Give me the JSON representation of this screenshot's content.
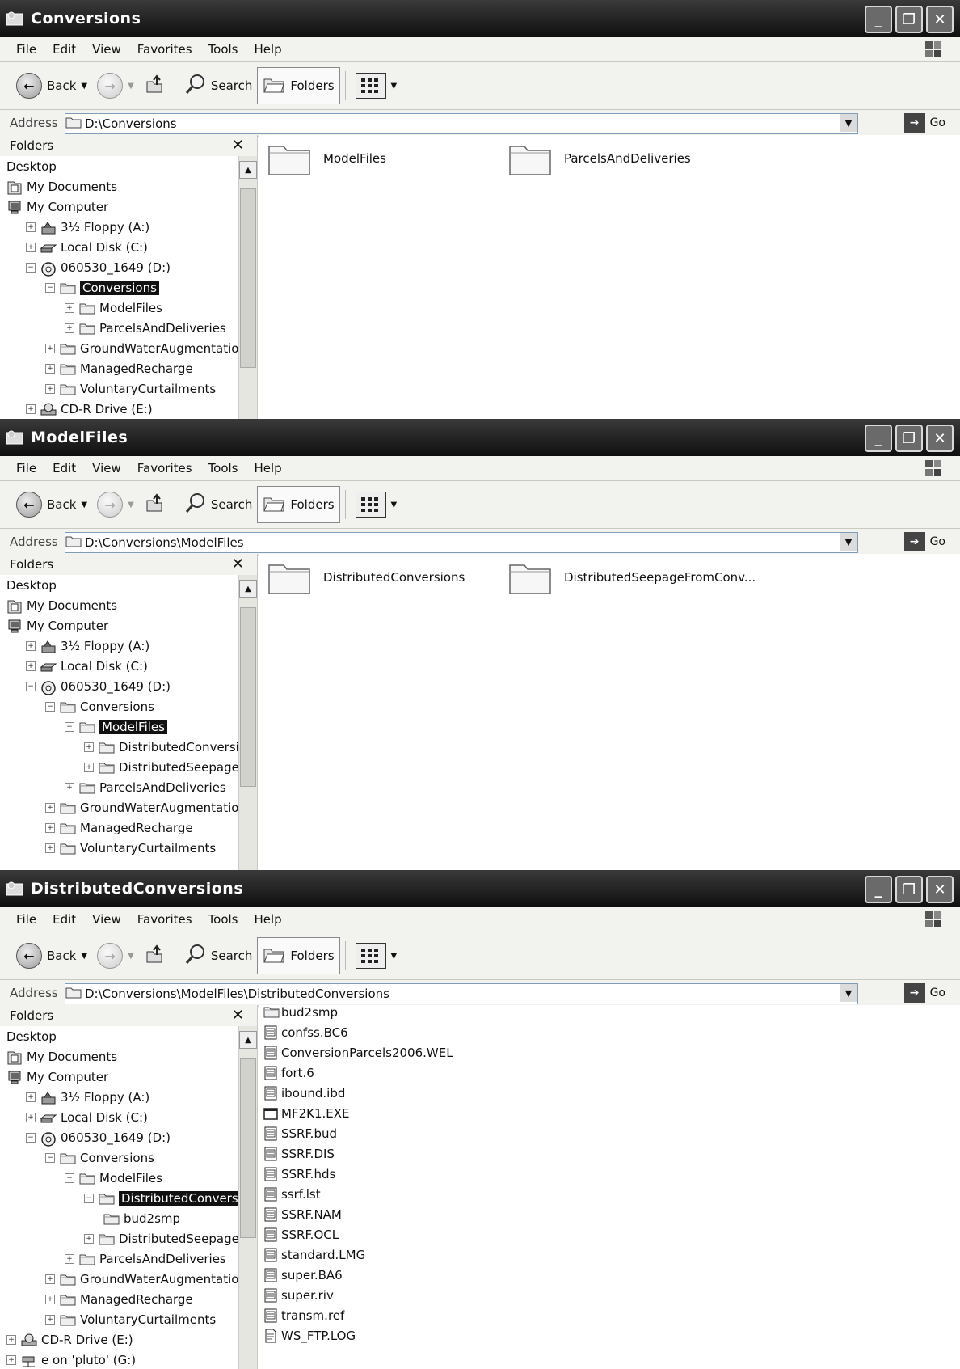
{
  "windows": [
    {
      "title": "Conversions",
      "menu": [
        "File",
        "Edit",
        "View",
        "Favorites",
        "Tools",
        "Help"
      ],
      "toolbar": {
        "back": "Back",
        "search": "Search",
        "folders": "Folders"
      },
      "address": {
        "label": "Address",
        "value": "D:\\Conversions",
        "go": "Go"
      },
      "folders_header": "Folders",
      "tree": [
        {
          "label": "Desktop",
          "icon": "none",
          "exp": "",
          "indent": 0
        },
        {
          "label": "My Documents",
          "icon": "documents-icon",
          "exp": "",
          "indent": 0
        },
        {
          "label": "My Computer",
          "icon": "computer-icon",
          "exp": "",
          "indent": 0
        },
        {
          "label": "3½ Floppy (A:)",
          "icon": "floppy-icon",
          "exp": "+",
          "indent": 1
        },
        {
          "label": "Local Disk (C:)",
          "icon": "disk-icon",
          "exp": "+",
          "indent": 1
        },
        {
          "label": "060530_1649 (D:)",
          "icon": "cd-icon",
          "exp": "-",
          "indent": 1
        },
        {
          "label": "Conversions",
          "icon": "folder-icon",
          "exp": "-",
          "indent": 2,
          "selected": true
        },
        {
          "label": "ModelFiles",
          "icon": "folder-icon",
          "exp": "+",
          "indent": 3
        },
        {
          "label": "ParcelsAndDeliveries",
          "icon": "folder-icon",
          "exp": "+",
          "indent": 3
        },
        {
          "label": "GroundWaterAugmentation",
          "icon": "folder-icon",
          "exp": "+",
          "indent": 2
        },
        {
          "label": "ManagedRecharge",
          "icon": "folder-icon",
          "exp": "+",
          "indent": 2
        },
        {
          "label": "VoluntaryCurtailments",
          "icon": "folder-icon",
          "exp": "+",
          "indent": 2
        },
        {
          "label": "CD-R Drive (E:)",
          "icon": "cdr-icon",
          "exp": "+",
          "indent": 1
        }
      ],
      "tiles": [
        "ModelFiles",
        "ParcelsAndDeliveries"
      ]
    },
    {
      "title": "ModelFiles",
      "menu": [
        "File",
        "Edit",
        "View",
        "Favorites",
        "Tools",
        "Help"
      ],
      "toolbar": {
        "back": "Back",
        "search": "Search",
        "folders": "Folders"
      },
      "address": {
        "label": "Address",
        "value": "D:\\Conversions\\ModelFiles",
        "go": "Go"
      },
      "folders_header": "Folders",
      "tree": [
        {
          "label": "Desktop",
          "icon": "none",
          "exp": "",
          "indent": 0
        },
        {
          "label": "My Documents",
          "icon": "documents-icon",
          "exp": "",
          "indent": 0
        },
        {
          "label": "My Computer",
          "icon": "computer-icon",
          "exp": "",
          "indent": 0
        },
        {
          "label": "3½ Floppy (A:)",
          "icon": "floppy-icon",
          "exp": "+",
          "indent": 1
        },
        {
          "label": "Local Disk (C:)",
          "icon": "disk-icon",
          "exp": "+",
          "indent": 1
        },
        {
          "label": "060530_1649 (D:)",
          "icon": "cd-icon",
          "exp": "-",
          "indent": 1
        },
        {
          "label": "Conversions",
          "icon": "folder-icon",
          "exp": "-",
          "indent": 2
        },
        {
          "label": "ModelFiles",
          "icon": "folder-icon",
          "exp": "-",
          "indent": 3,
          "selected": true
        },
        {
          "label": "DistributedConversic",
          "icon": "folder-icon",
          "exp": "+",
          "indent": 4
        },
        {
          "label": "DistributedSeepagef",
          "icon": "folder-icon",
          "exp": "+",
          "indent": 4
        },
        {
          "label": "ParcelsAndDeliveries",
          "icon": "folder-icon",
          "exp": "+",
          "indent": 3
        },
        {
          "label": "GroundWaterAugmentation",
          "icon": "folder-icon",
          "exp": "+",
          "indent": 2
        },
        {
          "label": "ManagedRecharge",
          "icon": "folder-icon",
          "exp": "+",
          "indent": 2
        },
        {
          "label": "VoluntaryCurtailments",
          "icon": "folder-icon",
          "exp": "+",
          "indent": 2
        }
      ],
      "tiles": [
        "DistributedConversions",
        "DistributedSeepageFromConv..."
      ]
    },
    {
      "title": "DistributedConversions",
      "menu": [
        "File",
        "Edit",
        "View",
        "Favorites",
        "Tools",
        "Help"
      ],
      "toolbar": {
        "back": "Back",
        "search": "Search",
        "folders": "Folders"
      },
      "address": {
        "label": "Address",
        "value": "D:\\Conversions\\ModelFiles\\DistributedConversions",
        "go": "Go"
      },
      "folders_header": "Folders",
      "tree": [
        {
          "label": "Desktop",
          "icon": "none",
          "exp": "",
          "indent": 0
        },
        {
          "label": "My Documents",
          "icon": "documents-icon",
          "exp": "",
          "indent": 0
        },
        {
          "label": "My Computer",
          "icon": "computer-icon",
          "exp": "",
          "indent": 0
        },
        {
          "label": "3½ Floppy (A:)",
          "icon": "floppy-icon",
          "exp": "+",
          "indent": 1
        },
        {
          "label": "Local Disk (C:)",
          "icon": "disk-icon",
          "exp": "+",
          "indent": 1
        },
        {
          "label": "060530_1649 (D:)",
          "icon": "cd-icon",
          "exp": "-",
          "indent": 1
        },
        {
          "label": "Conversions",
          "icon": "folder-icon",
          "exp": "-",
          "indent": 2
        },
        {
          "label": "ModelFiles",
          "icon": "folder-icon",
          "exp": "-",
          "indent": 3
        },
        {
          "label": "DistributedConversior",
          "icon": "folder-icon",
          "exp": "-",
          "indent": 4,
          "selected": true
        },
        {
          "label": "bud2smp",
          "icon": "folder-icon",
          "exp": "",
          "indent": 5
        },
        {
          "label": "DistributedSeepageFr",
          "icon": "folder-icon",
          "exp": "+",
          "indent": 4
        },
        {
          "label": "ParcelsAndDeliveries",
          "icon": "folder-icon",
          "exp": "+",
          "indent": 3
        },
        {
          "label": "GroundWaterAugmentation",
          "icon": "folder-icon",
          "exp": "+",
          "indent": 2
        },
        {
          "label": "ManagedRecharge",
          "icon": "folder-icon",
          "exp": "+",
          "indent": 2
        },
        {
          "label": "VoluntaryCurtailments",
          "icon": "folder-icon",
          "exp": "+",
          "indent": 2
        },
        {
          "label": "CD-R Drive (E:)",
          "icon": "cdr-icon",
          "exp": "+",
          "indent": 0
        },
        {
          "label": "e on 'pluto' (G:)",
          "icon": "network-drive-icon",
          "exp": "+",
          "indent": 0
        }
      ],
      "files": [
        {
          "name": "bud2smp",
          "icon": "folder-icon"
        },
        {
          "name": "confss.BC6",
          "icon": "file-icon"
        },
        {
          "name": "ConversionParcels2006.WEL",
          "icon": "file-icon"
        },
        {
          "name": "fort.6",
          "icon": "file-icon"
        },
        {
          "name": "ibound.ibd",
          "icon": "file-icon"
        },
        {
          "name": "MF2K1.EXE",
          "icon": "exe-icon"
        },
        {
          "name": "SSRF.bud",
          "icon": "file-icon"
        },
        {
          "name": "SSRF.DIS",
          "icon": "file-icon"
        },
        {
          "name": "SSRF.hds",
          "icon": "file-icon"
        },
        {
          "name": "ssrf.lst",
          "icon": "file-icon"
        },
        {
          "name": "SSRF.NAM",
          "icon": "file-icon"
        },
        {
          "name": "SSRF.OCL",
          "icon": "file-icon"
        },
        {
          "name": "standard.LMG",
          "icon": "file-icon"
        },
        {
          "name": "super.BA6",
          "icon": "file-icon"
        },
        {
          "name": "super.riv",
          "icon": "file-icon"
        },
        {
          "name": "transm.ref",
          "icon": "file-icon"
        },
        {
          "name": "WS_FTP.LOG",
          "icon": "text-file-icon"
        }
      ]
    }
  ]
}
